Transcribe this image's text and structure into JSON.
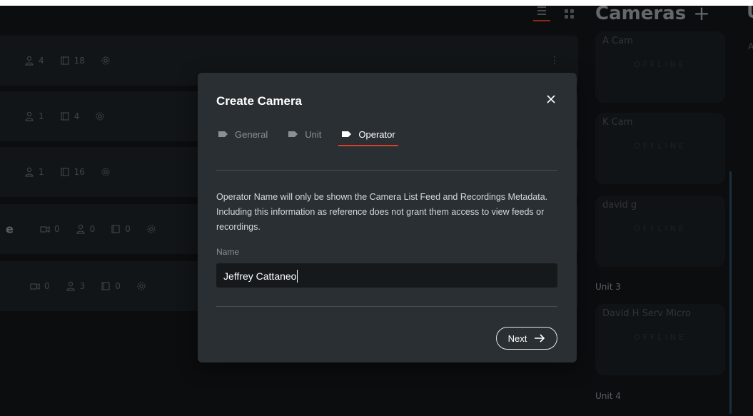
{
  "header": {
    "cameras_title": "Cameras",
    "add_symbol": "+",
    "truncated_next_title": "U",
    "truncated_next_sub": "A"
  },
  "background_rows": [
    {
      "title": "",
      "operators": "4",
      "recordings": "18",
      "cameras": "",
      "has_menu": true
    },
    {
      "title": "",
      "operators": "1",
      "recordings": "4",
      "cameras": ""
    },
    {
      "title": "",
      "operators": "1",
      "recordings": "16",
      "cameras": ""
    },
    {
      "title": "e",
      "cameras": "0",
      "operators": "0",
      "recordings": "0"
    },
    {
      "title": "",
      "cameras": "0",
      "operators": "3",
      "recordings": "0"
    }
  ],
  "camera_list": {
    "cards": [
      {
        "name": "A Cam",
        "status": "OFFLINE"
      },
      {
        "name": "K Cam",
        "status": "OFFLINE"
      },
      {
        "name": "david g",
        "status": "OFFLINE"
      },
      {
        "name": "David H Serv Micro",
        "status": "OFFLINE"
      }
    ],
    "units": [
      "Unit 3",
      "Unit 4"
    ]
  },
  "modal": {
    "title": "Create Camera",
    "tabs": [
      {
        "label": "General",
        "active": false
      },
      {
        "label": "Unit",
        "active": false
      },
      {
        "label": "Operator",
        "active": true
      }
    ],
    "description": "Operator Name will only be shown the Camera List Feed and Recordings Metadata. Including this information as reference does not grant them access to view feeds or recordings.",
    "name_label": "Name",
    "name_value": "Jeffrey Cattaneo",
    "next_label": "Next"
  },
  "colors": {
    "accent": "#d9402a",
    "modal_bg": "#2a2f33",
    "input_bg": "#15191c",
    "app_bg": "#111417"
  }
}
